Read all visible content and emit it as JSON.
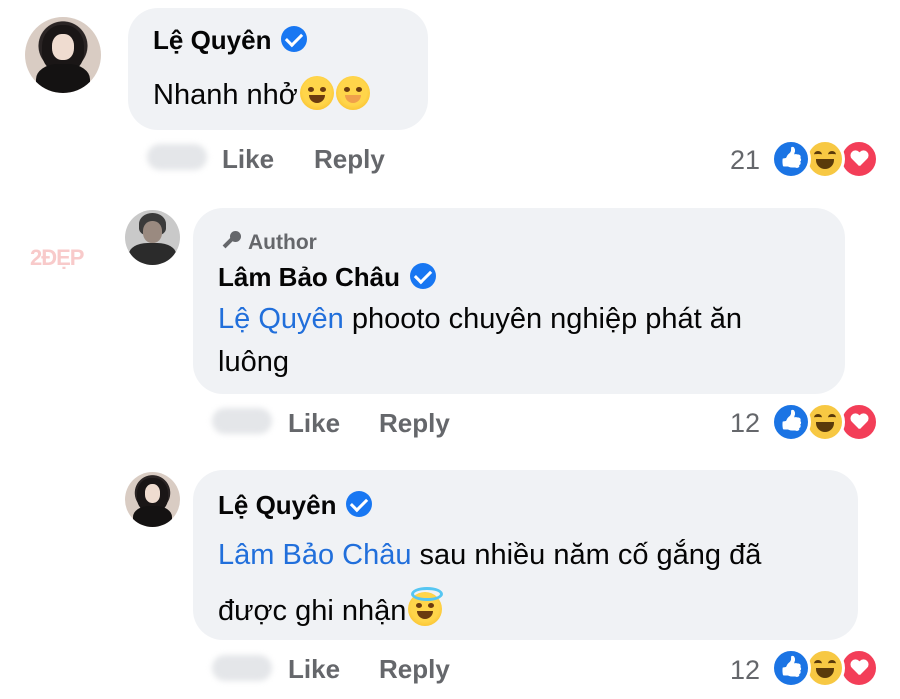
{
  "watermark": "2ĐẸP",
  "comments": [
    {
      "author": "Lệ Quyên",
      "verified": true,
      "text": "Nhanh nhở",
      "emojis": [
        "rolling-on-floor-laughing",
        "face-with-hand-over-mouth"
      ],
      "actions": {
        "like": "Like",
        "reply": "Reply"
      },
      "reaction_count": "21",
      "reactions": [
        "like",
        "haha",
        "love"
      ]
    },
    {
      "badge": "Author",
      "author": "Lâm Bảo Châu",
      "verified": true,
      "mention": "Lệ Quyên",
      "text_line1": " phooto chuyên nghiệp phát ăn",
      "text_line2": "luông",
      "actions": {
        "like": "Like",
        "reply": "Reply"
      },
      "reaction_count": "12",
      "reactions": [
        "like",
        "haha",
        "love"
      ]
    },
    {
      "author": "Lệ Quyên",
      "verified": true,
      "mention": "Lâm Bảo Châu",
      "text_line1": " sau nhiều năm cố gắng đã",
      "text_line2": "được ghi nhận",
      "emojis": [
        "smiling-face-with-halo"
      ],
      "actions": {
        "like": "Like",
        "reply": "Reply"
      },
      "reaction_count": "12",
      "reactions": [
        "like",
        "haha",
        "love"
      ]
    }
  ],
  "colors": {
    "bubble": "#f0f2f5",
    "mention": "#216fdb",
    "verified": "#1877f2",
    "muted": "#65676b"
  }
}
